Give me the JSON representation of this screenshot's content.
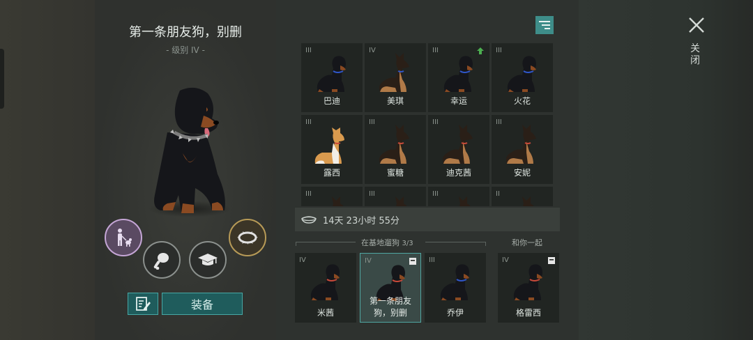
{
  "dog": {
    "name": "第一条朋友狗，别删",
    "level": "- 级别 IV -"
  },
  "actions": {
    "equip_label": "装备"
  },
  "dog_grid": [
    {
      "tier": "III",
      "name": "巴迪",
      "breed": "rottweiler",
      "collar": "#3057c9",
      "upgrade": false
    },
    {
      "tier": "IV",
      "name": "美琪",
      "breed": "shepherd",
      "collar": "#3057c9",
      "upgrade": false
    },
    {
      "tier": "III",
      "name": "幸运",
      "breed": "rottweiler",
      "collar": "#3057c9",
      "upgrade": true
    },
    {
      "tier": "III",
      "name": "火花",
      "breed": "rottweiler",
      "collar": "#3057c9",
      "upgrade": false
    },
    {
      "tier": "III",
      "name": "露西",
      "breed": "corgi",
      "collar": "#c94a3a",
      "upgrade": false
    },
    {
      "tier": "III",
      "name": "蜜糖",
      "breed": "shepherd",
      "collar": "#c94a3a",
      "upgrade": false
    },
    {
      "tier": "III",
      "name": "迪克茜",
      "breed": "shepherd",
      "collar": "#c94a3a",
      "upgrade": false
    },
    {
      "tier": "III",
      "name": "安妮",
      "breed": "shepherd",
      "collar": "#c94a3a",
      "upgrade": false
    },
    {
      "tier": "III",
      "name": "",
      "breed": "shepherd",
      "collar": "#c94a3a",
      "upgrade": false
    },
    {
      "tier": "III",
      "name": "",
      "breed": "shepherd",
      "collar": "#c94a3a",
      "upgrade": false
    },
    {
      "tier": "III",
      "name": "",
      "breed": "shepherd",
      "collar": "#c94a3a",
      "upgrade": false
    },
    {
      "tier": "II",
      "name": "",
      "breed": "shepherd",
      "collar": "#c94a3a",
      "upgrade": false
    }
  ],
  "timer": {
    "text": "14天 23小时 55分"
  },
  "walk_section": {
    "label": "在基地遛狗",
    "count": "3/3"
  },
  "walk_slots": [
    {
      "tier": "IV",
      "name": "米茜",
      "collar": "#c94a3a",
      "selected": false,
      "locked": false
    },
    {
      "tier": "IV",
      "name_line1": "第一条朋友",
      "name_line2": "狗，别删",
      "collar": "#c94a3a",
      "selected": true,
      "locked": true
    },
    {
      "tier": "III",
      "name": "乔伊",
      "collar": "#3057c9",
      "selected": false,
      "locked": false
    }
  ],
  "with_you_section": {
    "label": "和你一起"
  },
  "with_you_slot": {
    "tier": "IV",
    "name": "格雷西",
    "collar": "#c94a3a",
    "locked": true
  },
  "close": {
    "label": "关闭"
  },
  "colors": {
    "accent_teal": "#1f5c5c",
    "accent_border": "#47a8a5",
    "upgrade_green": "#4caf50",
    "walk_purple": "#c5a6d6",
    "collar_gold": "#b89b57"
  },
  "icons": [
    "walk-icon",
    "food-icon",
    "training-icon",
    "collar-icon",
    "notes-icon",
    "filter-icon",
    "bowl-icon",
    "lock-icon",
    "close-icon",
    "upgrade-arrow-icon"
  ]
}
